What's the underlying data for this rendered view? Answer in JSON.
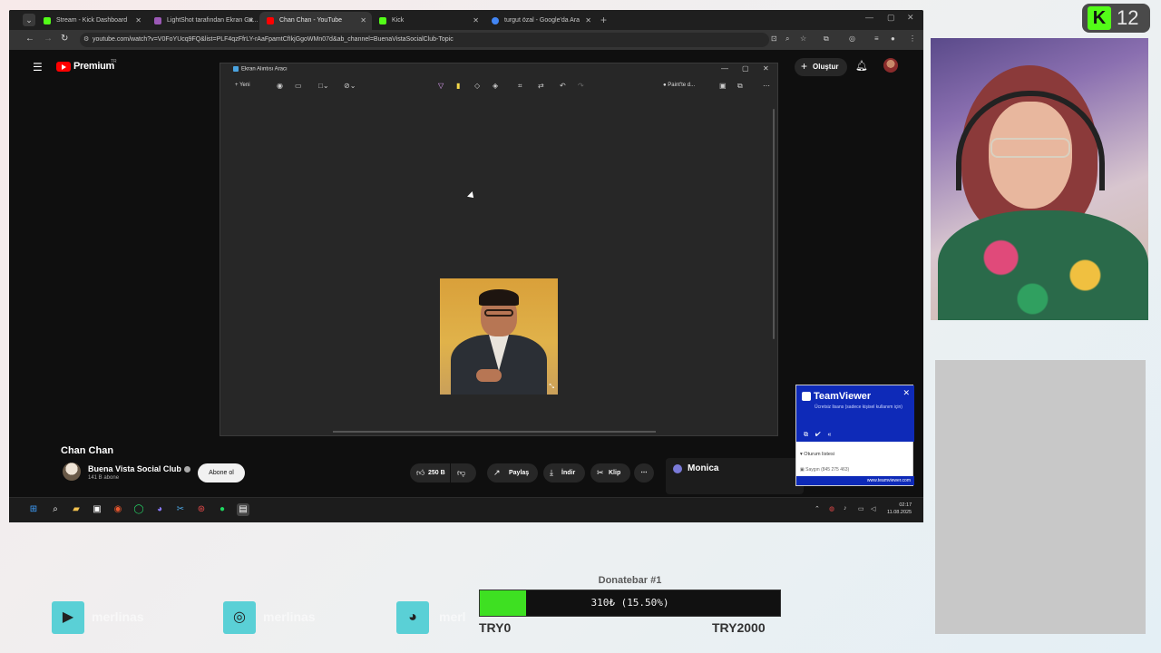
{
  "browser": {
    "tabs": [
      {
        "label": "Stream - Kick Dashboard",
        "color": "#53fc18"
      },
      {
        "label": "LightShot tarafından Ekran Gö...",
        "color": "#9b59b6"
      },
      {
        "label": "Chan Chan - YouTube",
        "color": "#ff0000"
      },
      {
        "label": "Kick",
        "color": "#53fc18"
      },
      {
        "label": "turgut özal - Google'da Ara",
        "color": "#4285f4"
      }
    ],
    "url": "youtube.com/watch?v=V0FoYUcq9FQ&list=PLF4qzFfrLY-rAaFpamtCfIkjGgoWMn07d&ab_channel=BuenaVistaSocialClub-Topic"
  },
  "youtube": {
    "premium": "Premium",
    "region": "TR",
    "create": "Oluştur",
    "video_title": "Chan Chan",
    "channel": "Buena Vista Social Club",
    "subscribers": "141 B abone",
    "subscribe": "Abone ol",
    "likes": "250 B",
    "share": "Paylaş",
    "download": "İndir",
    "clip": "Klip",
    "monica": "Monica"
  },
  "snipping_tool": {
    "title": "Ekran Alıntısı Aracı",
    "new": "Yeni",
    "paint": "Paint'te d..."
  },
  "teamviewer": {
    "title": "TeamViewer",
    "subtitle": "Ücretsiz lisans (sadece kişisel kullanım için)",
    "sessions": "Oturum listesi",
    "item": "Saygın (845 275 463)",
    "footer": "www.teamviewer.com"
  },
  "clock": {
    "time": "02:17",
    "date": "11.08.2025"
  },
  "kick": {
    "viewers": "12",
    "accent": "#53fc18"
  },
  "donate": {
    "title": "Donatebar #1",
    "label": "310₺ (15.50%)",
    "progress": 0.155,
    "min": "TRY0",
    "max": "TRY2000"
  },
  "socials": [
    {
      "icon": "youtube-icon",
      "name": "merlinas"
    },
    {
      "icon": "instagram-icon",
      "name": "merlinas"
    },
    {
      "icon": "discord-icon",
      "name": "merl"
    }
  ]
}
